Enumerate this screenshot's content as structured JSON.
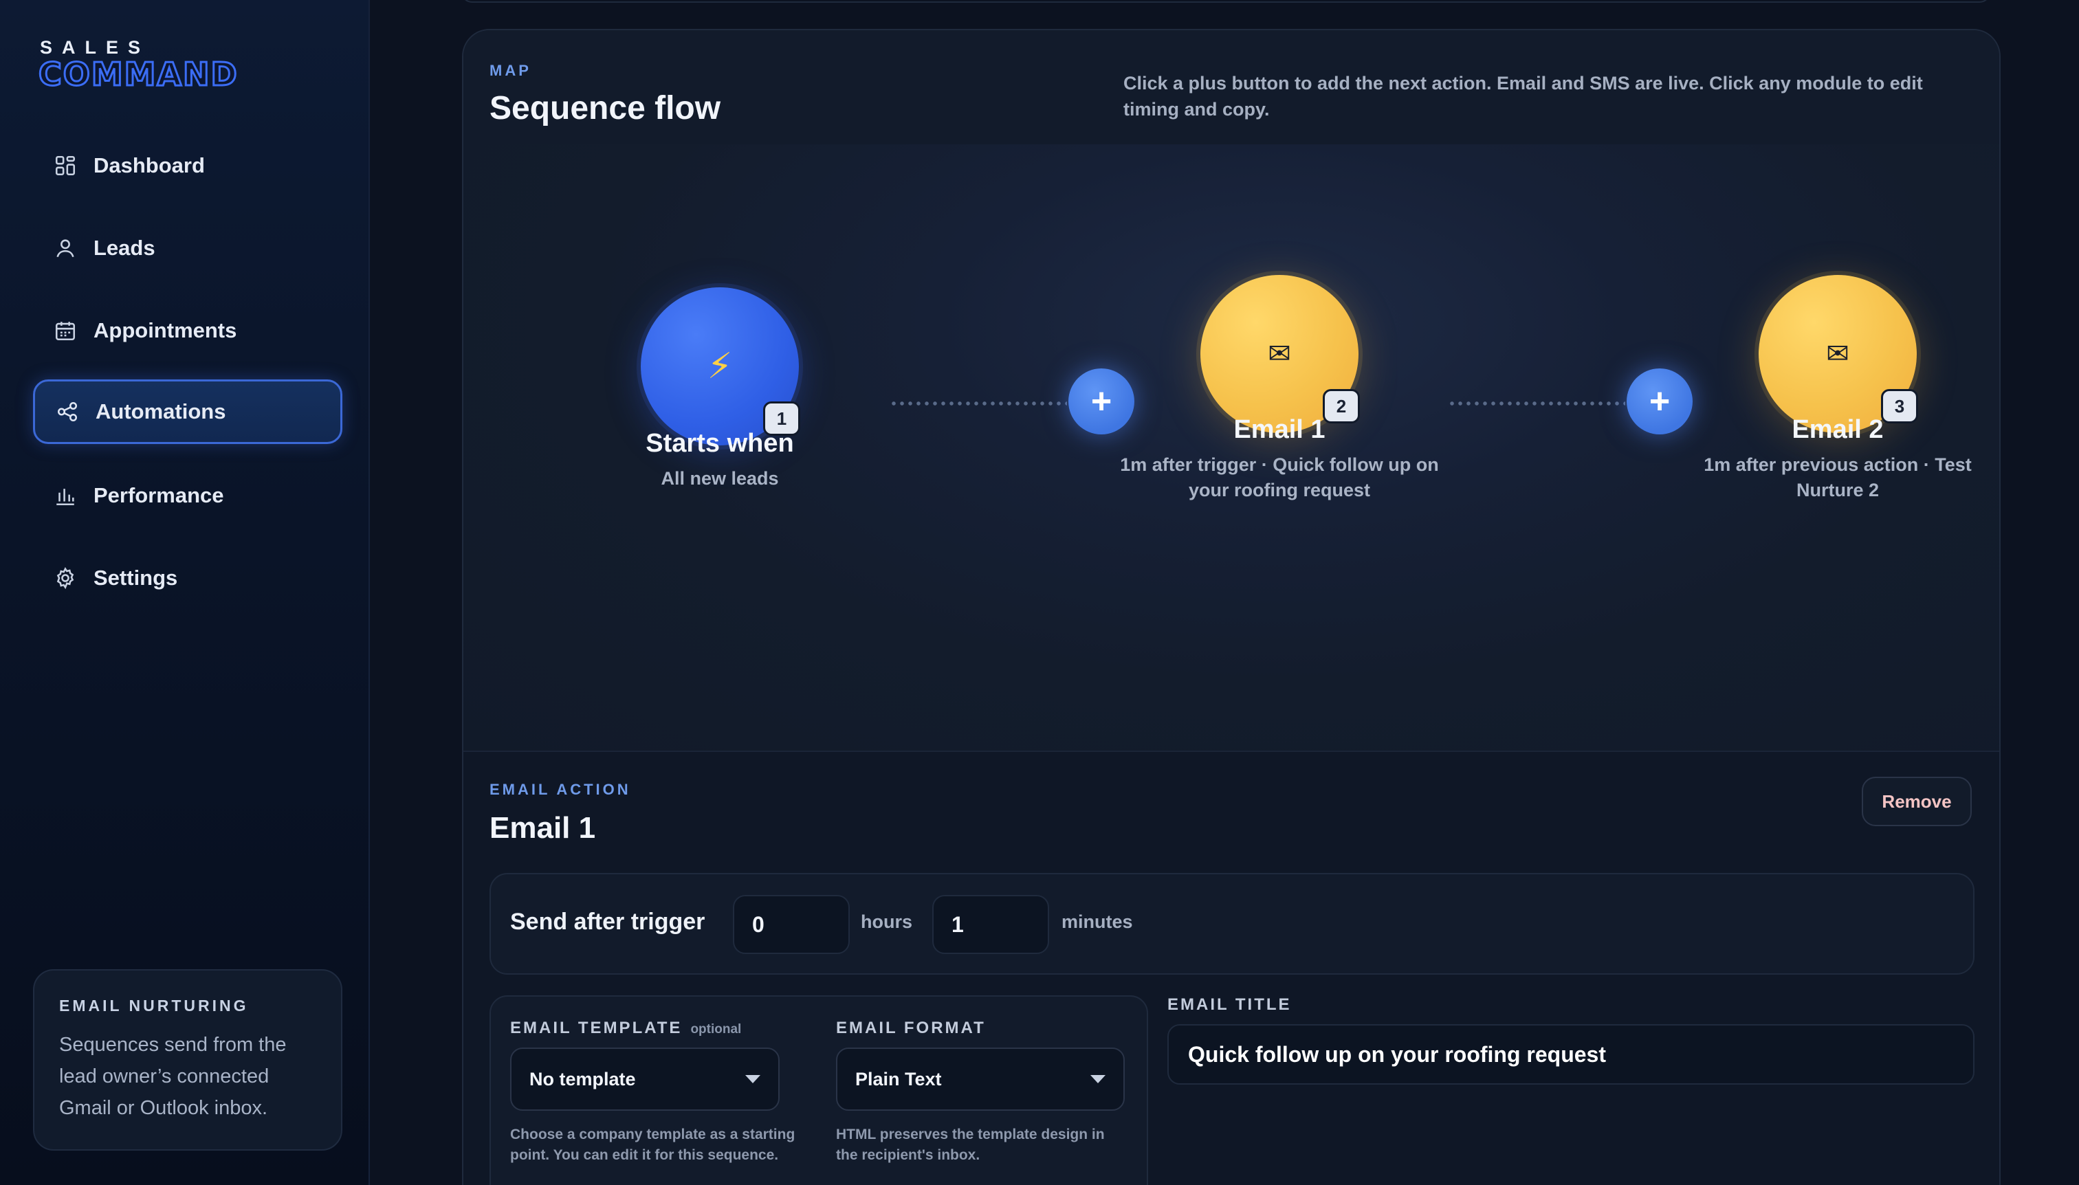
{
  "brand": {
    "top": "SALES",
    "main": "COMMAND"
  },
  "nav": [
    {
      "label": "Dashboard",
      "icon": "dashboard-grid-icon",
      "active": false
    },
    {
      "label": "Leads",
      "icon": "user-icon",
      "active": false
    },
    {
      "label": "Appointments",
      "icon": "calendar-icon",
      "active": false
    },
    {
      "label": "Automations",
      "icon": "share-nodes-icon",
      "active": true
    },
    {
      "label": "Performance",
      "icon": "bar-chart-icon",
      "active": false
    },
    {
      "label": "Settings",
      "icon": "gear-icon",
      "active": false
    }
  ],
  "promo": {
    "title": "EMAIL NURTURING",
    "body": "Sequences send from the lead owner’s connected Gmail or Outlook inbox."
  },
  "map": {
    "eyebrow": "MAP",
    "title": "Sequence flow",
    "hint": "Click a plus button to add the next action. Email and SMS are live. Click any module to edit timing and copy."
  },
  "nodes": [
    {
      "type": "trigger",
      "badge": "1",
      "title": "Starts when",
      "subtitle": "All new leads",
      "icon": "lightning-bolt-icon"
    },
    {
      "type": "email",
      "badge": "2",
      "title": "Email 1",
      "subtitle": "1m after trigger · Quick follow up on your roofing request",
      "icon": "envelope-icon"
    },
    {
      "type": "email",
      "badge": "3",
      "title": "Email 2",
      "subtitle": "1m after previous action · Test Nurture 2",
      "icon": "envelope-icon"
    }
  ],
  "add_button_symbol": "+",
  "action": {
    "eyebrow": "EMAIL ACTION",
    "title": "Email 1",
    "remove_label": "Remove",
    "send_label": "Send after trigger",
    "hours_value": "0",
    "hours_unit": "hours",
    "minutes_value": "1",
    "minutes_unit": "minutes",
    "template_label": "EMAIL TEMPLATE",
    "template_optional": "optional",
    "template_value": "No template",
    "template_help": "Choose a company template as a starting point. You can edit it for this sequence.",
    "format_label": "EMAIL FORMAT",
    "format_value": "Plain Text",
    "format_help": "HTML preserves the template design in the recipient's inbox.",
    "email_title_label": "EMAIL TITLE",
    "email_title_value": "Quick follow up on your roofing request"
  },
  "colors": {
    "accent": "#3b6df5",
    "trigger_node": "#2f5fe6",
    "email_node": "#f6c24c",
    "add_button": "#4a80ea"
  }
}
